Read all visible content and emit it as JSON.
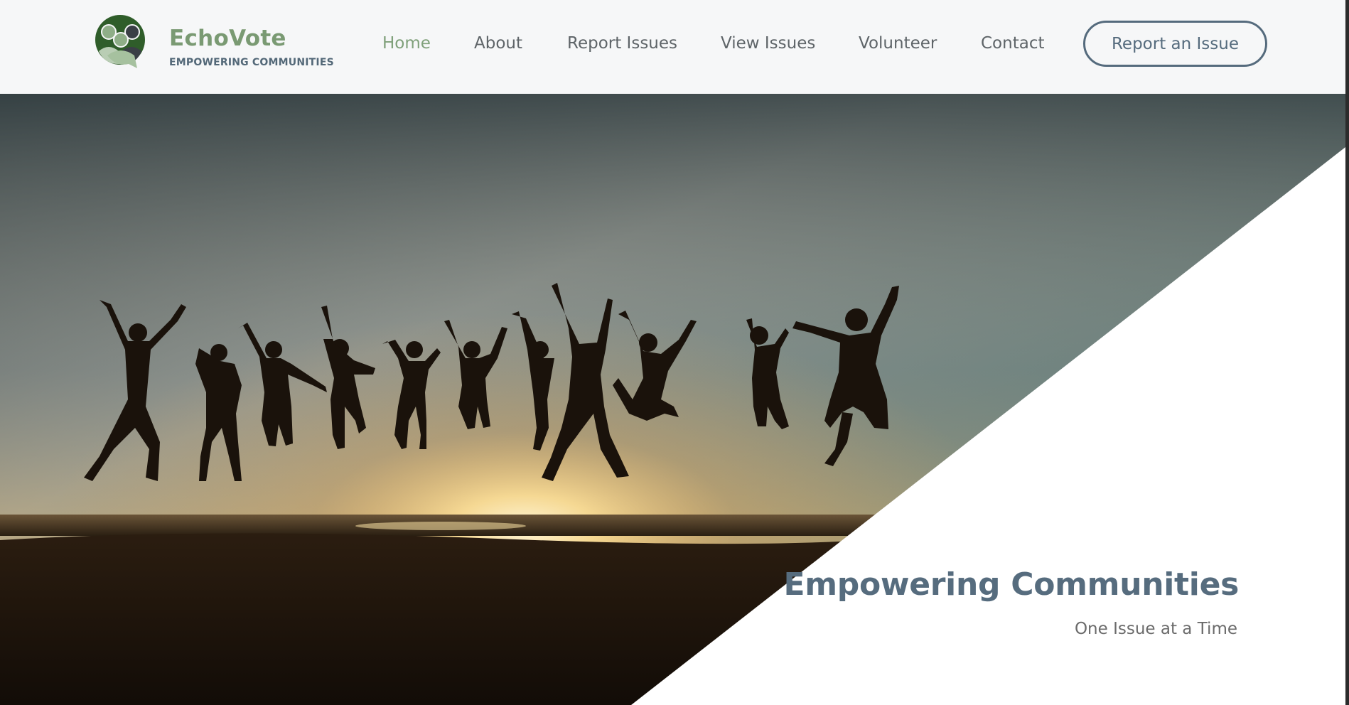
{
  "brand": {
    "name": "EchoVote",
    "tagline": "EMPOWERING COMMUNITIES",
    "logo_icon": "community-people-icon"
  },
  "nav": {
    "items": [
      {
        "label": "Home",
        "active": true
      },
      {
        "label": "About",
        "active": false
      },
      {
        "label": "Report Issues",
        "active": false
      },
      {
        "label": "View Issues",
        "active": false
      },
      {
        "label": "Volunteer",
        "active": false
      },
      {
        "label": "Contact",
        "active": false
      }
    ],
    "cta_label": "Report an Issue"
  },
  "hero": {
    "title": "Empowering Communities",
    "subtitle": "One Issue at a Time",
    "image_subject": "silhouettes jumping at sunset beach"
  },
  "colors": {
    "brand_green": "#7a9a73",
    "nav_active": "#7fa07a",
    "slate": "#556b7d",
    "nav_text": "#5e6468",
    "header_bg": "#f6f7f8"
  }
}
